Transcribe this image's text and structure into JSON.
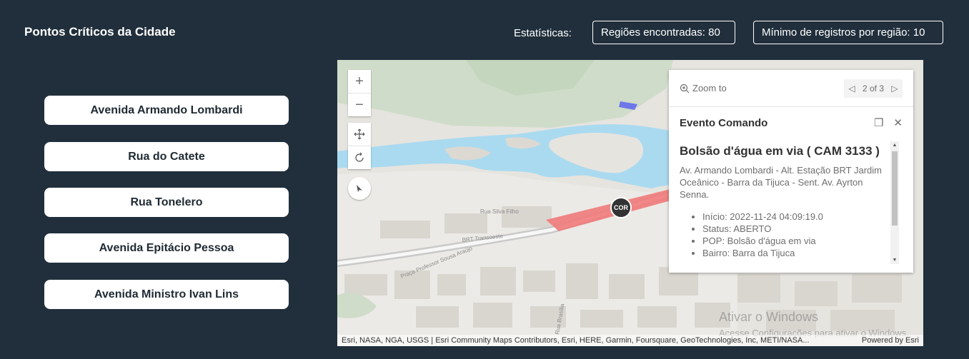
{
  "header": {
    "title": "Pontos Críticos da Cidade",
    "stats_label": "Estatísticas:",
    "regions_found": "Regiões encontradas: 80",
    "min_records": "Mínimo de registros por região: 10"
  },
  "streets": [
    {
      "label": "Avenida Armando Lombardi"
    },
    {
      "label": "Rua do Catete"
    },
    {
      "label": "Rua Tonelero"
    },
    {
      "label": "Avenida Epitácio Pessoa"
    },
    {
      "label": "Avenida Ministro Ivan Lins"
    }
  ],
  "map": {
    "marker_label": "COR",
    "attribution": "Esri, NASA, NGA, USGS | Esri Community Maps Contributors, Esri, HERE, Garmin, Foursquare, GeoTechnologies, Inc, METI/NASA...",
    "powered_by": "Powered by Esri",
    "watermark_title": "Ativar o Windows",
    "watermark_sub": "Acesse Configurações para ativar o Windows.",
    "labels": {
      "rua_silva_filho": "Rua Silva Filho",
      "praca": "Praça Professor Sousa Araújo",
      "brt": "BRT Transoeste",
      "rua_brasilia": "Rua Brasília"
    }
  },
  "popup": {
    "zoom_to": "Zoom to",
    "pager": "2 of 3",
    "layer_title": "Evento Comando",
    "event_title": "Bolsão d'água em via ( CAM 3133 )",
    "event_address": "Av. Armando Lombardi - Alt. Estação BRT Jardim Oceânico - Barra da Tijuca - Sent. Av. Ayrton Senna.",
    "details": [
      "Início: 2022-11-24 04:09:19.0",
      "Status: ABERTO",
      "POP: Bolsão d'água em via",
      "Bairro: Barra da Tijuca"
    ]
  },
  "colors": {
    "background": "#212f3c",
    "water": "#aadaf0",
    "event_segment": "#f07a7a"
  }
}
